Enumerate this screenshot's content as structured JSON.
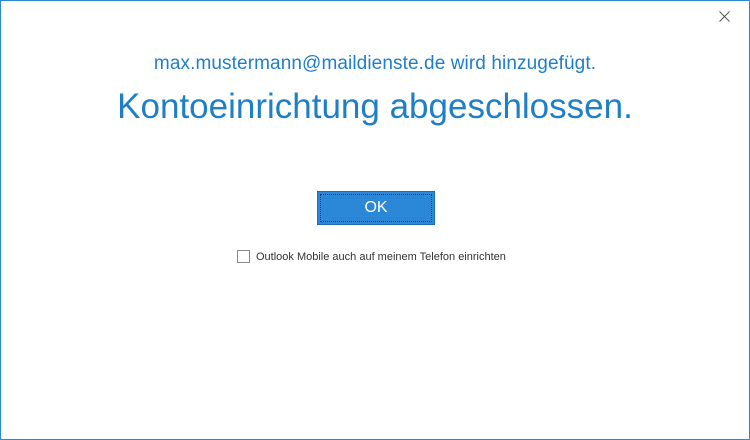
{
  "dialog": {
    "close_icon": "close-icon",
    "subtitle": "max.mustermann@maildienste.de wird hinzugefügt.",
    "title": "Kontoeinrichtung abgeschlossen.",
    "ok_label": "OK",
    "checkbox": {
      "label": "Outlook Mobile auch auf meinem Telefon einrichten",
      "checked": false
    }
  },
  "colors": {
    "accent": "#2b88d8",
    "heading_text": "#1e7fc8",
    "border": "#2b88d8"
  }
}
